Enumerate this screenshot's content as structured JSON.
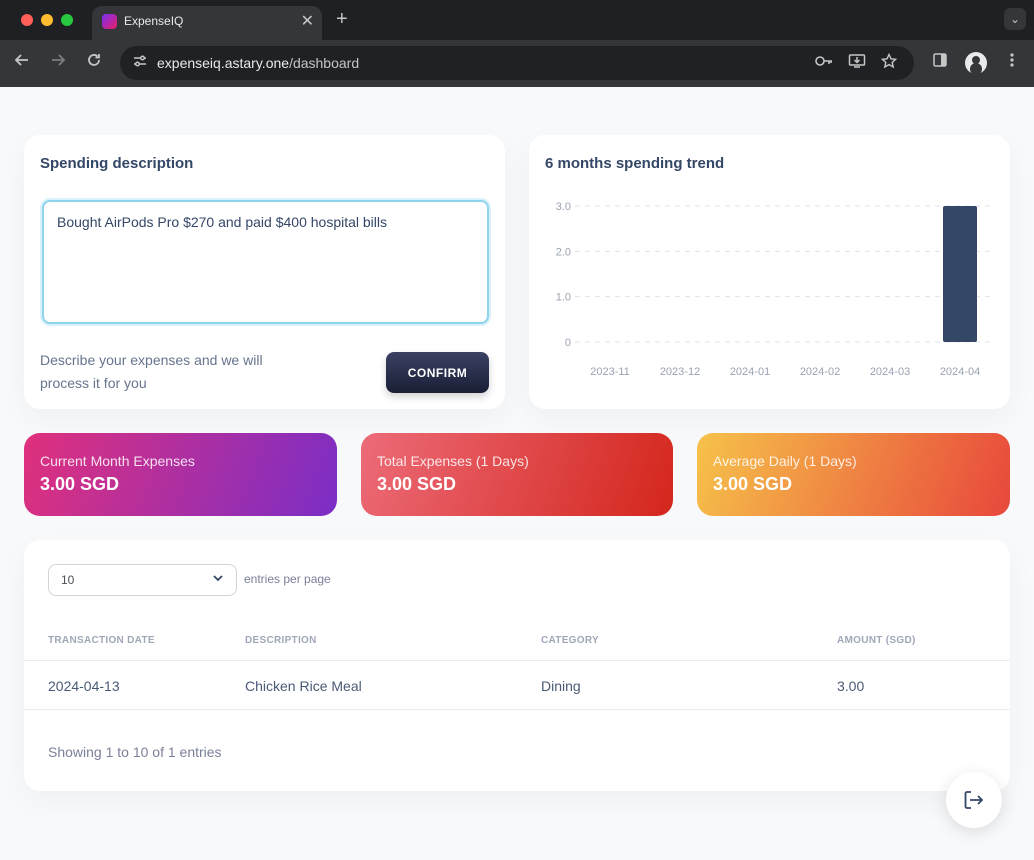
{
  "browser": {
    "tab_title": "ExpenseIQ",
    "url_host": "expenseiq.astary.one",
    "url_path": "/dashboard",
    "close_glyph": "✕",
    "new_tab_glyph": "+",
    "tab_menu_glyph": "⌄"
  },
  "description_card": {
    "title": "Spending description",
    "input_value": "Bought AirPods Pro $270 and paid $400 hospital bills",
    "help_text": "Describe your expenses and we will process it for you",
    "confirm_label": "CONFIRM"
  },
  "trend_card": {
    "title": "6 months spending trend"
  },
  "chart_data": {
    "type": "bar",
    "title": "6 months spending trend",
    "categories": [
      "2023-11",
      "2023-12",
      "2024-01",
      "2024-02",
      "2024-03",
      "2024-04"
    ],
    "values": [
      0,
      0,
      0,
      0,
      0,
      3.0
    ],
    "y_ticks": [
      "0",
      "1.0",
      "2.0",
      "3.0"
    ],
    "ylim": [
      0,
      3.0
    ],
    "grid": "dashed horizontal",
    "bar_color": "#344767"
  },
  "stats": [
    {
      "label": "Current Month Expenses",
      "value": "3.00 SGD"
    },
    {
      "label": "Total Expenses (1 Days)",
      "value": "3.00 SGD"
    },
    {
      "label": "Average Daily (1 Days)",
      "value": "3.00 SGD"
    }
  ],
  "table": {
    "per_page_value": "10",
    "per_page_label": "entries per page",
    "columns": [
      "TRANSACTION DATE",
      "DESCRIPTION",
      "CATEGORY",
      "AMOUNT (SGD)"
    ],
    "rows": [
      [
        "2024-04-13",
        "Chicken Rice Meal",
        "Dining",
        "3.00"
      ]
    ],
    "footer": "Showing 1 to 10 of 1 entries"
  },
  "colors": {
    "accent_navy": "#344767",
    "focus_ring": "#8fd3ed"
  },
  "icons": {
    "back": "back-arrow-icon",
    "forward": "forward-arrow-icon",
    "reload": "reload-icon",
    "site_settings": "tune-icon",
    "password": "key-icon",
    "install": "install-app-icon",
    "bookmark": "star-icon",
    "sidepanel": "side-panel-icon",
    "profile": "profile-icon",
    "menu": "kebab-menu-icon",
    "logout": "logout-icon"
  }
}
